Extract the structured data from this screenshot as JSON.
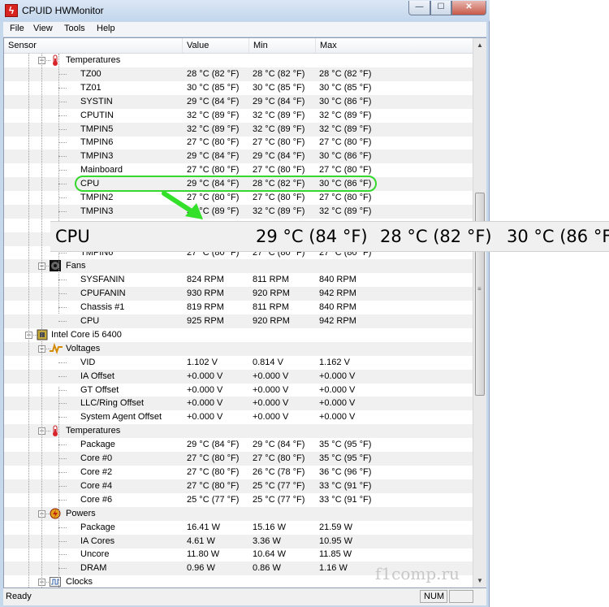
{
  "window": {
    "title": "CPUID HWMonitor",
    "icon": "flame-icon"
  },
  "title_buttons": {
    "minimize": "—",
    "maximize": "☐",
    "close": "✕"
  },
  "menu": [
    "File",
    "View",
    "Tools",
    "Help"
  ],
  "columns": [
    "Sensor",
    "Value",
    "Min",
    "Max"
  ],
  "rows": [
    {
      "type": "group",
      "level": 2,
      "name": "Temperatures",
      "icon": "thermometer-icon"
    },
    {
      "type": "sensor",
      "name": "TZ00",
      "value": "28 °C  (82 °F)",
      "min": "28 °C  (82 °F)",
      "max": "28 °C  (82 °F)"
    },
    {
      "type": "sensor",
      "name": "TZ01",
      "value": "30 °C  (85 °F)",
      "min": "30 °C  (85 °F)",
      "max": "30 °C  (85 °F)"
    },
    {
      "type": "sensor",
      "name": "SYSTIN",
      "value": "29 °C  (84 °F)",
      "min": "29 °C  (84 °F)",
      "max": "30 °C  (86 °F)"
    },
    {
      "type": "sensor",
      "name": "CPUTIN",
      "value": "32 °C  (89 °F)",
      "min": "32 °C  (89 °F)",
      "max": "32 °C  (89 °F)"
    },
    {
      "type": "sensor",
      "name": "TMPIN5",
      "value": "32 °C  (89 °F)",
      "min": "32 °C  (89 °F)",
      "max": "32 °C  (89 °F)"
    },
    {
      "type": "sensor",
      "name": "TMPIN6",
      "value": "27 °C  (80 °F)",
      "min": "27 °C  (80 °F)",
      "max": "27 °C  (80 °F)"
    },
    {
      "type": "sensor",
      "name": "TMPIN3",
      "value": "29 °C  (84 °F)",
      "min": "29 °C  (84 °F)",
      "max": "30 °C  (86 °F)"
    },
    {
      "type": "sensor",
      "name": "Mainboard",
      "value": "27 °C  (80 °F)",
      "min": "27 °C  (80 °F)",
      "max": "27 °C  (80 °F)"
    },
    {
      "type": "sensor",
      "name": "CPU",
      "value": "29 °C  (84 °F)",
      "min": "28 °C  (82 °F)",
      "max": "30 °C  (86 °F)"
    },
    {
      "type": "sensor",
      "name": "TMPIN2",
      "value": "27 °C  (80 °F)",
      "min": "27 °C  (80 °F)",
      "max": "27 °C  (80 °F)"
    },
    {
      "type": "sensor",
      "name": "TMPIN3",
      "value": "32 °C  (89 °F)",
      "min": "32 °C  (89 °F)",
      "max": "32 °C  (89 °F)"
    },
    {
      "type": "hidden"
    },
    {
      "type": "hidden"
    },
    {
      "type": "sensor",
      "name": "TMPIN6",
      "value": "27 °C  (80 °F)",
      "min": "27 °C  (80 °F)",
      "max": "27 °C  (80 °F)"
    },
    {
      "type": "group",
      "level": 2,
      "name": "Fans",
      "icon": "fan-icon"
    },
    {
      "type": "sensor",
      "name": "SYSFANIN",
      "value": "824 RPM",
      "min": "811 RPM",
      "max": "840 RPM"
    },
    {
      "type": "sensor",
      "name": "CPUFANIN",
      "value": "930 RPM",
      "min": "920 RPM",
      "max": "942 RPM"
    },
    {
      "type": "sensor",
      "name": "Chassis #1",
      "value": "819 RPM",
      "min": "811 RPM",
      "max": "840 RPM"
    },
    {
      "type": "sensor",
      "name": "CPU",
      "value": "925 RPM",
      "min": "920 RPM",
      "max": "942 RPM"
    },
    {
      "type": "group",
      "level": 1,
      "name": "Intel Core i5 6400",
      "icon": "chip-icon"
    },
    {
      "type": "group",
      "level": 2,
      "name": "Voltages",
      "icon": "voltage-icon"
    },
    {
      "type": "sensor",
      "name": "VID",
      "value": "1.102 V",
      "min": "0.814 V",
      "max": "1.162 V"
    },
    {
      "type": "sensor",
      "name": "IA Offset",
      "value": "+0.000 V",
      "min": "+0.000 V",
      "max": "+0.000 V"
    },
    {
      "type": "sensor",
      "name": "GT Offset",
      "value": "+0.000 V",
      "min": "+0.000 V",
      "max": "+0.000 V"
    },
    {
      "type": "sensor",
      "name": "LLC/Ring Offset",
      "value": "+0.000 V",
      "min": "+0.000 V",
      "max": "+0.000 V"
    },
    {
      "type": "sensor",
      "name": "System Agent Offset",
      "value": "+0.000 V",
      "min": "+0.000 V",
      "max": "+0.000 V"
    },
    {
      "type": "group",
      "level": 2,
      "name": "Temperatures",
      "icon": "thermometer-icon"
    },
    {
      "type": "sensor",
      "name": "Package",
      "value": "29 °C  (84 °F)",
      "min": "29 °C  (84 °F)",
      "max": "35 °C  (95 °F)"
    },
    {
      "type": "sensor",
      "name": "Core #0",
      "value": "27 °C  (80 °F)",
      "min": "27 °C  (80 °F)",
      "max": "35 °C  (95 °F)"
    },
    {
      "type": "sensor",
      "name": "Core #2",
      "value": "27 °C  (80 °F)",
      "min": "26 °C  (78 °F)",
      "max": "36 °C  (96 °F)"
    },
    {
      "type": "sensor",
      "name": "Core #4",
      "value": "27 °C  (80 °F)",
      "min": "25 °C  (77 °F)",
      "max": "33 °C  (91 °F)"
    },
    {
      "type": "sensor",
      "name": "Core #6",
      "value": "25 °C  (77 °F)",
      "min": "25 °C  (77 °F)",
      "max": "33 °C  (91 °F)"
    },
    {
      "type": "group",
      "level": 2,
      "name": "Powers",
      "icon": "power-icon"
    },
    {
      "type": "sensor",
      "name": "Package",
      "value": "16.41 W",
      "min": "15.16 W",
      "max": "21.59 W"
    },
    {
      "type": "sensor",
      "name": "IA Cores",
      "value": "4.61 W",
      "min": "3.36 W",
      "max": "10.95 W"
    },
    {
      "type": "sensor",
      "name": "Uncore",
      "value": "11.80 W",
      "min": "10.64 W",
      "max": "11.85 W"
    },
    {
      "type": "sensor",
      "name": "DRAM",
      "value": "0.96 W",
      "min": "0.86 W",
      "max": "1.16 W"
    },
    {
      "type": "group",
      "level": 2,
      "name": "Clocks",
      "icon": "clock-icon"
    }
  ],
  "zoom": {
    "name": "CPU",
    "value": "29 °C  (84 °F)",
    "min": "28 °C  (82 °F)",
    "max": "30 °C  (86 °F)"
  },
  "status": {
    "text": "Ready",
    "num": "NUM"
  },
  "watermark": "f1comp.ru",
  "colors": {
    "highlight": "#35d82c",
    "arrow": "#33e02a",
    "row_alt": "#f0f0f0"
  }
}
